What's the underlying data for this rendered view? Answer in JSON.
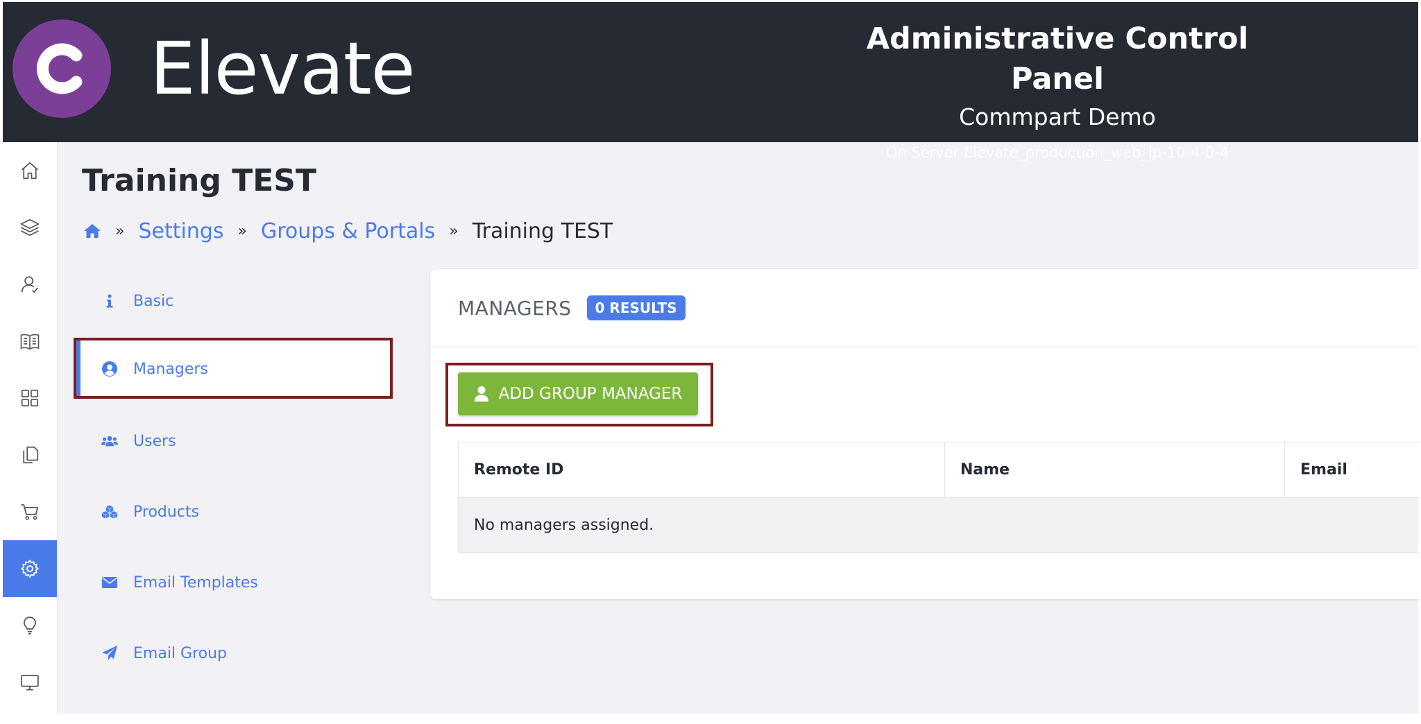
{
  "header": {
    "logo_letter": "C",
    "brand": "Elevate",
    "panel_title": "Administrative Control Panel",
    "org_name": "Commpart Demo",
    "server_info": "On Server Elevate_production_web_ip-10-4-0-4",
    "logo_color": "#7b3f98"
  },
  "rail": {
    "items": [
      {
        "icon": "home-icon",
        "active": false
      },
      {
        "icon": "layers-icon",
        "active": false
      },
      {
        "icon": "user-icon",
        "active": false
      },
      {
        "icon": "book-icon",
        "active": false
      },
      {
        "icon": "grid-icon",
        "active": false
      },
      {
        "icon": "documents-icon",
        "active": false
      },
      {
        "icon": "cart-icon",
        "active": false
      },
      {
        "icon": "gear-icon",
        "active": true
      },
      {
        "icon": "lightbulb-icon",
        "active": false
      },
      {
        "icon": "monitor-icon",
        "active": false
      }
    ]
  },
  "page": {
    "title": "Training TEST",
    "breadcrumb": {
      "sep": "»",
      "items": [
        "Settings",
        "Groups & Portals"
      ],
      "current": "Training TEST"
    }
  },
  "menu": {
    "items": [
      {
        "label": "Basic",
        "icon": "info-icon"
      },
      {
        "label": "Managers",
        "icon": "user-circle-icon",
        "active": true
      },
      {
        "label": "Users",
        "icon": "users-icon"
      },
      {
        "label": "Products",
        "icon": "cubes-icon"
      },
      {
        "label": "Email Templates",
        "icon": "envelope-icon"
      },
      {
        "label": "Email Group",
        "icon": "paper-plane-icon"
      }
    ]
  },
  "managers": {
    "title": "MANAGERS",
    "results": "0 RESULTS",
    "add_button": "ADD GROUP MANAGER",
    "columns": [
      "Remote ID",
      "Name",
      "Email"
    ],
    "empty": "No managers assigned."
  },
  "colors": {
    "header_bg": "#262a33",
    "accent": "#4a7be8",
    "button_green": "#7cb73c",
    "highlight_frame": "#7b1e1e"
  }
}
